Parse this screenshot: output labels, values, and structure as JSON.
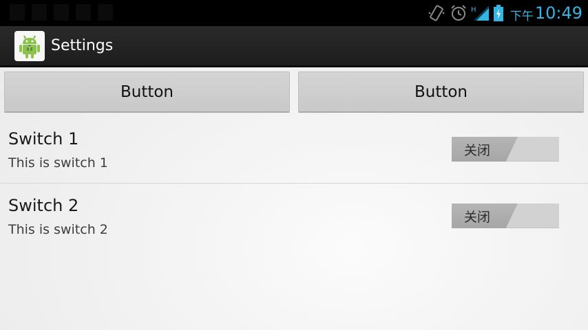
{
  "status_bar": {
    "time": "10:49",
    "am_pm": "下午",
    "network_type": "H",
    "icons": [
      "vibrate-icon",
      "alarm-icon",
      "signal-icon",
      "battery-charging-icon"
    ]
  },
  "action_bar": {
    "title": "Settings",
    "icon": "android-app-icon"
  },
  "buttons": [
    {
      "label": "Button"
    },
    {
      "label": "Button"
    }
  ],
  "switches": [
    {
      "title": "Switch 1",
      "summary": "This is switch 1",
      "state_label": "关闭",
      "checked": false
    },
    {
      "title": "Switch 2",
      "summary": "This is switch 2",
      "state_label": "关闭",
      "checked": false
    }
  ],
  "colors": {
    "accent": "#33b5e5",
    "action_bar": "#1f1f1f",
    "status_bar": "#000000"
  }
}
